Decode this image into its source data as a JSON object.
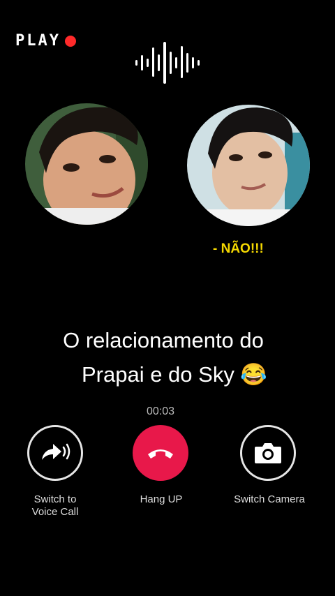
{
  "header": {
    "play_label": "PLAY",
    "recording_color": "#ff2a2a"
  },
  "call": {
    "subtitle": "- NÃO!!!",
    "caption_line1": "O relacionamento do",
    "caption_line2": "Prapai e do Sky 😂",
    "timer": "00:03"
  },
  "controls": {
    "voice_label_1": "Switch to",
    "voice_label_2": "Voice Call",
    "hangup_label": "Hang UP",
    "camera_label": "Switch Camera",
    "hangup_color": "#e8184a"
  }
}
